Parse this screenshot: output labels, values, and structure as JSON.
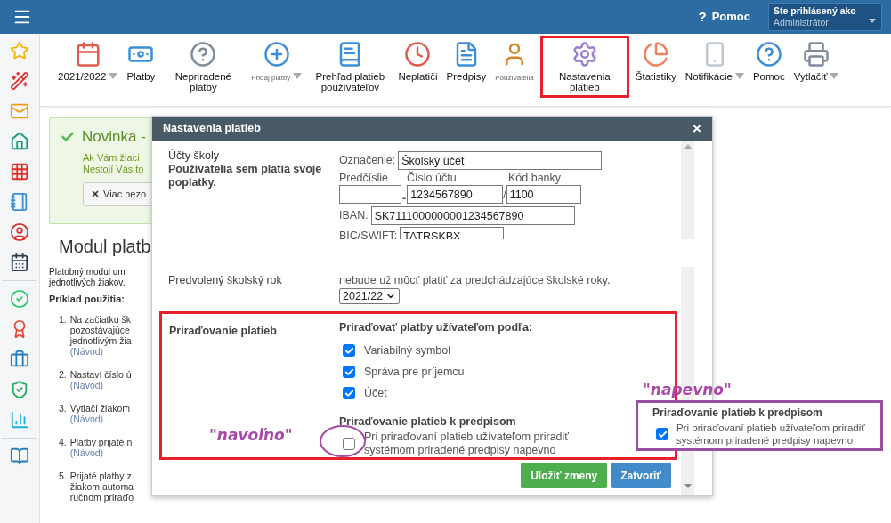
{
  "top_bar": {
    "help": {
      "icon_text": "?",
      "label": "Pomoc"
    },
    "login": {
      "caption": "Ste prihlásený ako",
      "value": "Administrátor"
    }
  },
  "toolbar": [
    {
      "label": "2021/2022",
      "caret": true,
      "small": false,
      "highlighted": false
    },
    {
      "label": "Platby",
      "caret": false,
      "small": false,
      "highlighted": false
    },
    {
      "label": "Nepriradené platby",
      "caret": false,
      "small": false,
      "highlighted": false
    },
    {
      "label": "Pridaj platby",
      "caret": true,
      "small": true,
      "highlighted": false
    },
    {
      "label": "Prehľad platieb používateľov",
      "caret": false,
      "small": false,
      "highlighted": false
    },
    {
      "label": "Neplatiči",
      "caret": false,
      "small": false,
      "highlighted": false
    },
    {
      "label": "Predpisy",
      "caret": false,
      "small": false,
      "highlighted": false
    },
    {
      "label": "Používatelia",
      "caret": false,
      "small": true,
      "highlighted": false
    },
    {
      "label": "Nastavenia platieb",
      "caret": false,
      "small": false,
      "highlighted": true
    },
    {
      "label": "Štatistiky",
      "caret": false,
      "small": false,
      "highlighted": false
    },
    {
      "label": "Notifikácie",
      "caret": true,
      "small": false,
      "highlighted": false
    },
    {
      "label": "Pomoc",
      "caret": false,
      "small": false,
      "highlighted": false
    },
    {
      "label": "Vytlačiť",
      "caret": true,
      "small": false,
      "highlighted": false
    }
  ],
  "notice": {
    "title": "Novinka -",
    "lines": [
      "Ak Vám žiaci",
      "Nestojí Vás to"
    ],
    "button": "Viac nezo"
  },
  "page": {
    "title": "Modul platb",
    "intro": [
      "Platobný modul um",
      "jednotlivých žiakov."
    ],
    "example_heading": "Príklad použitia:",
    "steps": [
      {
        "number": "1.",
        "lines": [
          "Na začiatku šk",
          "pozostávajúce",
          "jednotlivým žia"
        ],
        "link": "(Návod)"
      },
      {
        "number": "2.",
        "lines": [
          "Nastaví číslo ú"
        ],
        "link": "(Návod)"
      },
      {
        "number": "3.",
        "lines": [
          "Vytlačí žiakom"
        ],
        "link": "(Návod)"
      },
      {
        "number": "4.",
        "lines": [
          "Platby prijaté n"
        ],
        "link": "(Návod)"
      },
      {
        "number": "5.",
        "lines": [
          "Prijaté platby z",
          "žiakom automa",
          "ručnom priraďo"
        ]
      }
    ]
  },
  "dialog": {
    "title": "Nastavenia platieb",
    "close": "×",
    "accounts": {
      "title": "Účty školy",
      "description": "Používatelia sem platia svoje poplatky.",
      "designation_label": "Označenie:",
      "designation": "Školský účet",
      "prefix_label": "Predčíslie",
      "number_label": "Číslo účtu",
      "bank_label": "Kód banky",
      "number": "1234567890",
      "dash": "-",
      "slash": "/",
      "bank": "1100",
      "iban_label": "IBAN:",
      "iban": "SK7111000000001234567890",
      "bic_label": "BIC/SWIFT:",
      "bic": "TATRSKBX"
    },
    "school_year": {
      "title_lines": [
        "Predvolený školský rok"
      ],
      "description_lines": [
        "nebude už môcť platiť za predchádzajúce školské roky."
      ],
      "value": "2021/22"
    },
    "assignment": {
      "highlighted": true,
      "title": "Priraďovanie platieb",
      "heading": "Priraďovať platby užívateľom podľa:",
      "options": [
        {
          "label": "Variabilný symbol",
          "checked": true
        },
        {
          "label": "Správa pre príjemcu",
          "checked": true
        },
        {
          "label": "Účet",
          "checked": true
        }
      ],
      "subheading": "Priraďovanie platieb k predpisom",
      "fixed": {
        "label": "Pri priraďovaní platieb užívateľom priradiť systémom priradené predpisy napevno",
        "checked": false
      },
      "annotation": "\"navoľno\""
    },
    "buttons": [
      {
        "label": "Uložiť zmeny",
        "kind": "save"
      },
      {
        "label": "Zatvoriť",
        "kind": "close"
      }
    ]
  },
  "callout": {
    "annotation": "\"napevno\"",
    "heading": "Priraďovanie platieb k predpisom",
    "label": "Pri priraďovaní platieb užívateľom priradiť systémom priradené predpisy napevno",
    "checked": true
  }
}
